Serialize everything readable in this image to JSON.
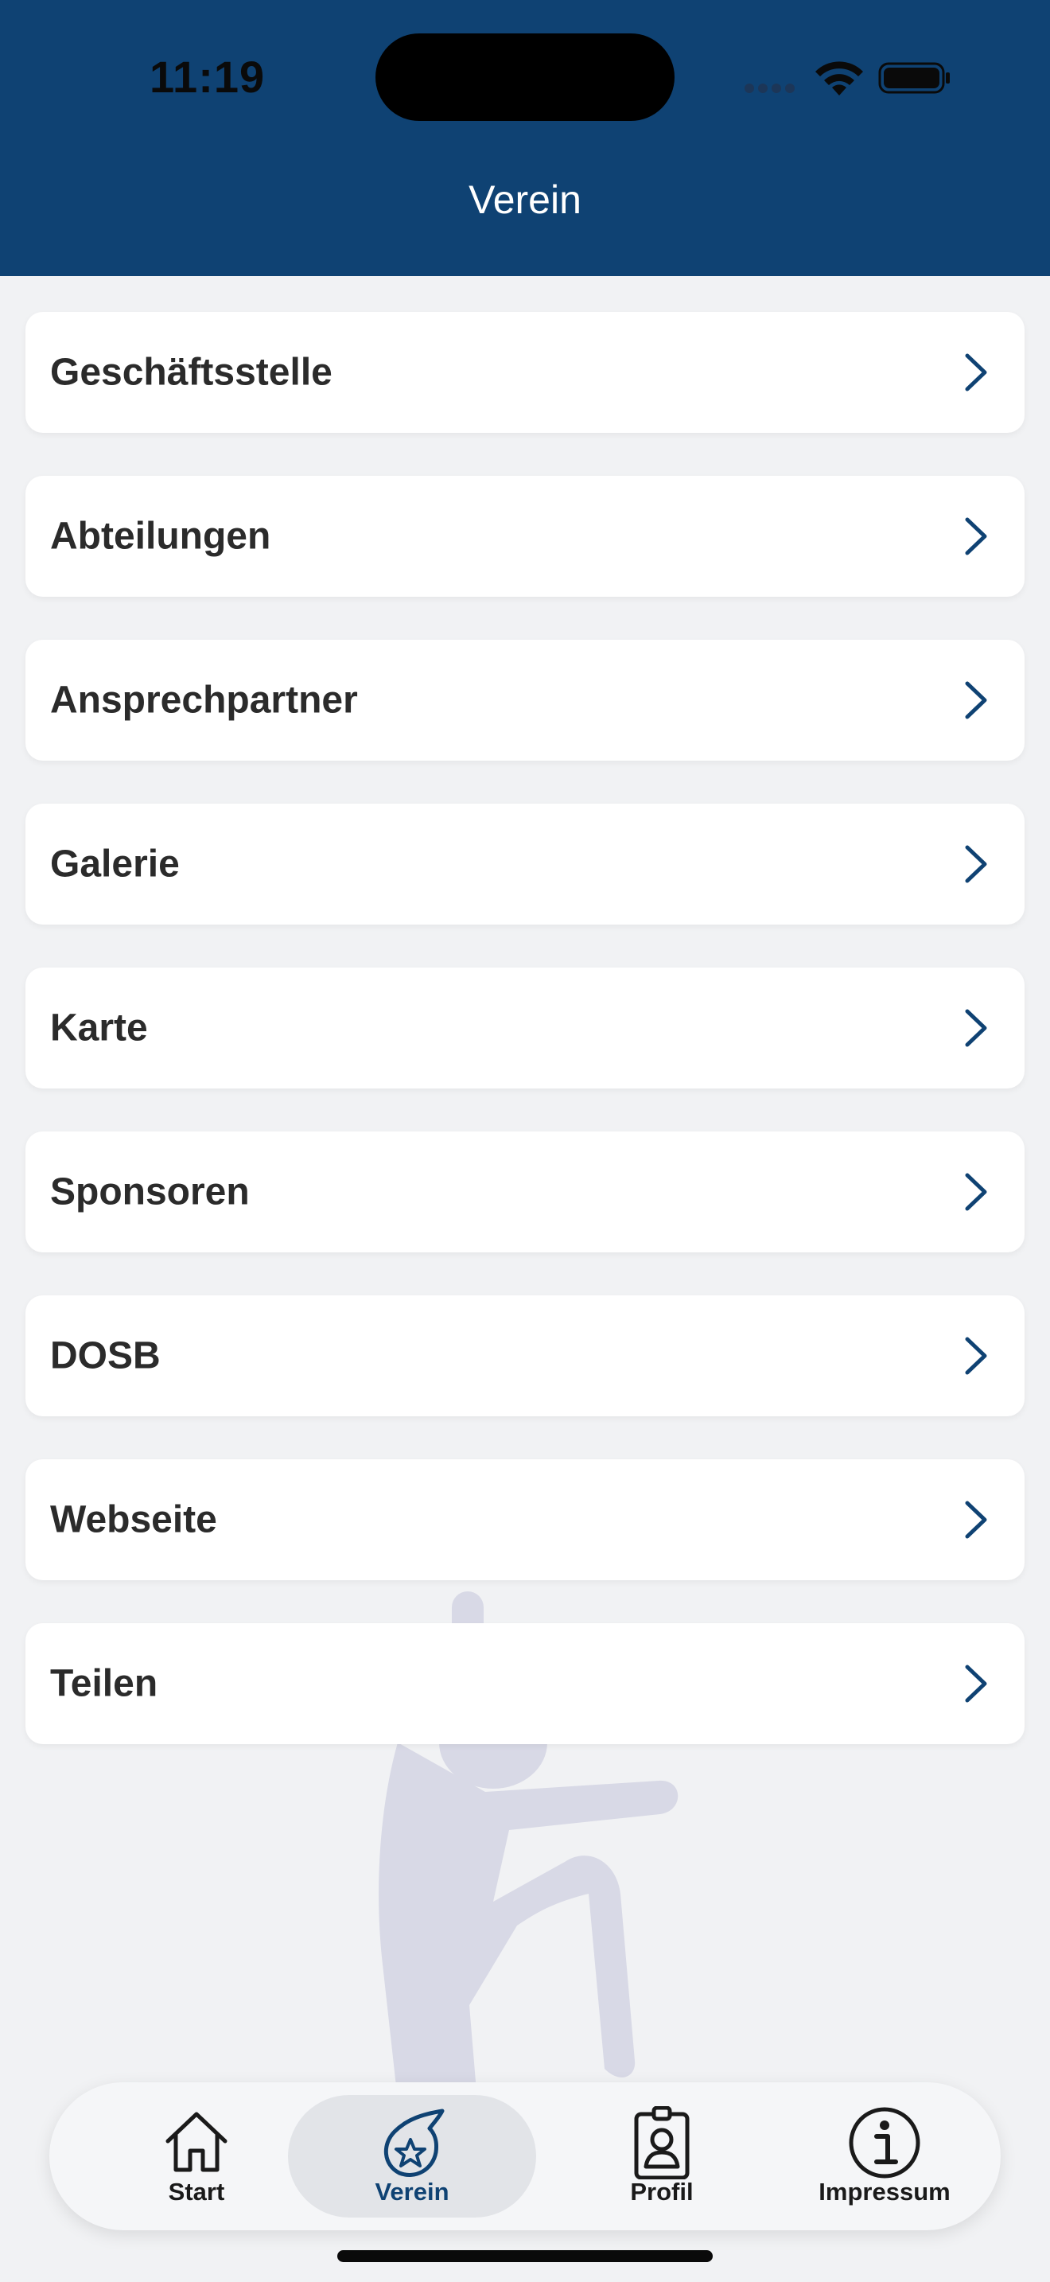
{
  "status_bar": {
    "time": "11:19"
  },
  "header": {
    "title": "Verein"
  },
  "menu": {
    "items": [
      {
        "label": "Geschäftsstelle"
      },
      {
        "label": "Abteilungen"
      },
      {
        "label": "Ansprechpartner"
      },
      {
        "label": "Galerie"
      },
      {
        "label": "Karte"
      },
      {
        "label": "Sponsoren"
      },
      {
        "label": "DOSB"
      },
      {
        "label": "Webseite"
      },
      {
        "label": "Teilen"
      }
    ]
  },
  "tabbar": {
    "active": "Verein",
    "tabs": [
      {
        "label": "Start",
        "icon": "home-icon"
      },
      {
        "label": "Verein",
        "icon": "club-star-icon"
      },
      {
        "label": "Profil",
        "icon": "profile-badge-icon"
      },
      {
        "label": "Impressum",
        "icon": "info-icon"
      }
    ]
  },
  "colors": {
    "header_bg": "#0f4273",
    "accent": "#0f4273",
    "page_bg": "#f1f2f4",
    "card_bg": "#ffffff",
    "watermark": "#d8d9e6"
  }
}
